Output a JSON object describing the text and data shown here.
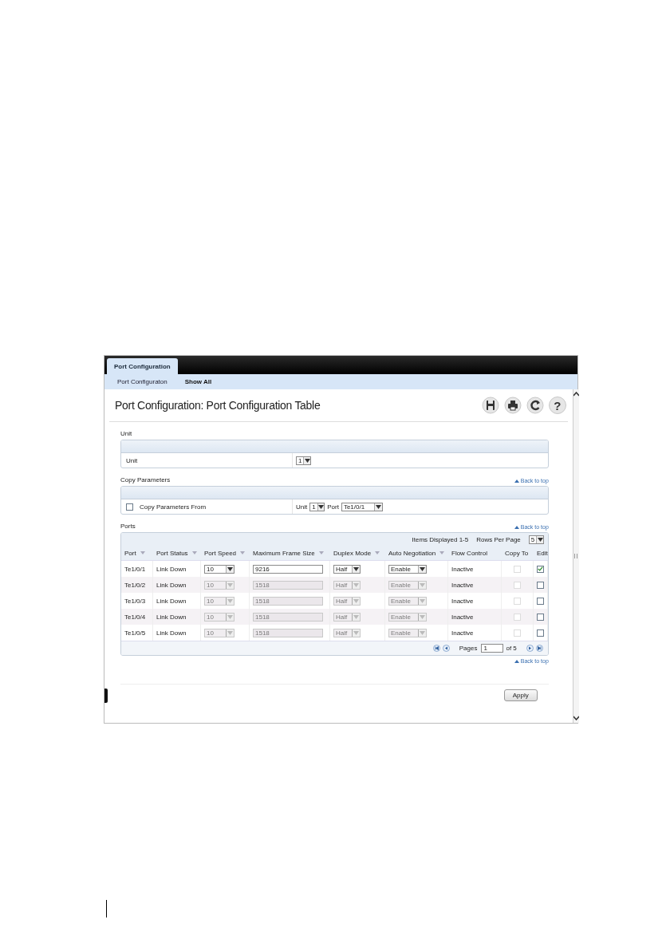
{
  "tabs": [
    {
      "label": "Port Configuration",
      "selected": true
    }
  ],
  "subnav": [
    {
      "label": "Port Configuraton",
      "selected": false
    },
    {
      "label": "Show All",
      "selected": true
    }
  ],
  "title": "Port Configuration: Port Configuration Table",
  "toolbar": [
    {
      "kind": "save"
    },
    {
      "kind": "print"
    },
    {
      "kind": "refresh"
    },
    {
      "kind": "help",
      "glyph": "?"
    }
  ],
  "unit_section": {
    "heading": "Unit",
    "label": "Unit",
    "value": "1"
  },
  "copy_section": {
    "heading": "Copy Parameters",
    "back_link": "Back to top",
    "checkbox_label": "Copy Parameters From",
    "checked": false,
    "unit_label": "Unit",
    "unit_value": "1",
    "port_label": "Port",
    "port_value": "Te1/0/1"
  },
  "ports": {
    "heading": "Ports",
    "back_link": "Back to top",
    "items_displayed": "Items Displayed 1-5",
    "rows_per_page_label": "Rows Per Page",
    "rows_per_page": "5",
    "columns": [
      {
        "label": "Port",
        "sortable": true
      },
      {
        "label": "Port Status",
        "sortable": true
      },
      {
        "label": "Port Speed",
        "sortable": true
      },
      {
        "label": "Maximum Frame Size",
        "sortable": true
      },
      {
        "label": "Duplex Mode",
        "sortable": true
      },
      {
        "label": "Auto Negotiation",
        "sortable": true
      },
      {
        "label": "Flow Control",
        "sortable": false
      },
      {
        "label": "Copy To",
        "sortable": false
      },
      {
        "label": "Edit",
        "sortable": false
      }
    ],
    "rows": [
      {
        "port": "Te1/0/1",
        "status": "Link Down",
        "speed": "10",
        "frame_size": "9216",
        "duplex": "Half",
        "auto_negotiation": "Enable",
        "flow_control": "Inactive",
        "copy_to": false,
        "edit": true,
        "disabled": false
      },
      {
        "port": "Te1/0/2",
        "status": "Link Down",
        "speed": "10",
        "frame_size": "1518",
        "duplex": "Half",
        "auto_negotiation": "Enable",
        "flow_control": "Inactive",
        "copy_to": false,
        "edit": false,
        "disabled": true
      },
      {
        "port": "Te1/0/3",
        "status": "Link Down",
        "speed": "10",
        "frame_size": "1518",
        "duplex": "Half",
        "auto_negotiation": "Enable",
        "flow_control": "Inactive",
        "copy_to": false,
        "edit": false,
        "disabled": true
      },
      {
        "port": "Te1/0/4",
        "status": "Link Down",
        "speed": "10",
        "frame_size": "1518",
        "duplex": "Half",
        "auto_negotiation": "Enable",
        "flow_control": "Inactive",
        "copy_to": false,
        "edit": false,
        "disabled": true
      },
      {
        "port": "Te1/0/5",
        "status": "Link Down",
        "speed": "10",
        "frame_size": "1518",
        "duplex": "Half",
        "auto_negotiation": "Enable",
        "flow_control": "Inactive",
        "copy_to": false,
        "edit": false,
        "disabled": true
      }
    ],
    "pages_label": "Pages",
    "page": "1",
    "page_total": "of 5",
    "bottom_back_link": "Back to top"
  },
  "apply": "Apply"
}
